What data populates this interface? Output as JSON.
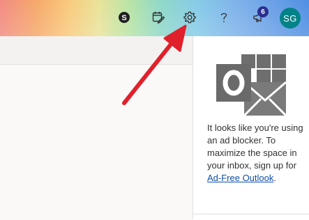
{
  "header": {
    "icons": [
      "skype-icon",
      "calendar-edit-icon",
      "gear-icon",
      "help-icon",
      "megaphone-icon"
    ],
    "notification_count": "6",
    "avatar_initials": "SG"
  },
  "ad_panel": {
    "message": "It looks like you're using an ad blocker. To maximize the space in your inbox, sign up for",
    "link_text": "Ad-Free Outlook",
    "trailing": "."
  },
  "colors": {
    "avatar": "#038387",
    "badge": "#2b2f8f",
    "arrow": "#e0202b",
    "link": "#0f4fa8"
  }
}
